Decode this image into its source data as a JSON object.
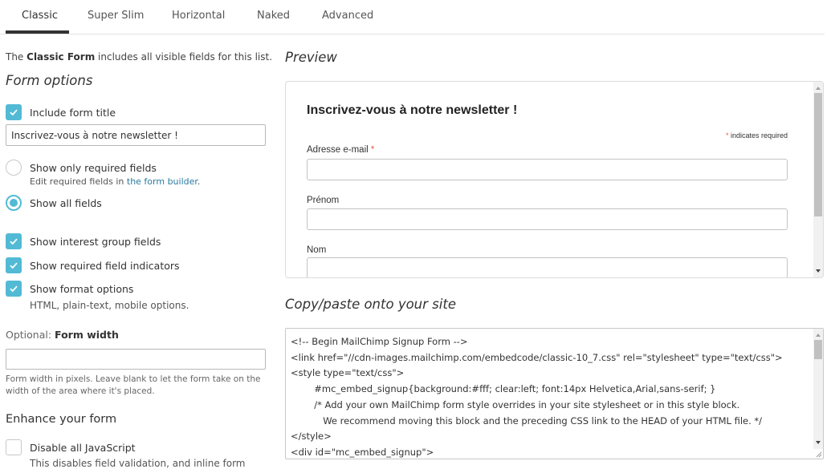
{
  "tabs": [
    {
      "label": "Classic",
      "active": true
    },
    {
      "label": "Super Slim",
      "active": false
    },
    {
      "label": "Horizontal",
      "active": false
    },
    {
      "label": "Naked",
      "active": false
    },
    {
      "label": "Advanced",
      "active": false
    }
  ],
  "left": {
    "intro": {
      "prefix": "The ",
      "bold": "Classic Form",
      "suffix": " includes all visible fields for this list."
    },
    "form_options_title": "Form options",
    "include_title": {
      "label": "Include form title",
      "checked": true
    },
    "title_input_value": "Inscrivez-vous à notre newsletter !",
    "radio_required": {
      "label": "Show only required fields",
      "selected": false,
      "sub_prefix": "Edit required fields in ",
      "sub_link": "the form builder",
      "sub_suffix": "."
    },
    "radio_all": {
      "label": "Show all fields",
      "selected": true
    },
    "checkboxes": [
      {
        "label": "Show interest group fields",
        "checked": true
      },
      {
        "label": "Show required field indicators",
        "checked": true
      },
      {
        "label": "Show format options",
        "checked": true
      }
    ],
    "format_sub": "HTML, plain-text, mobile options.",
    "form_width": {
      "optional_prefix": "Optional: ",
      "label": "Form width",
      "value": "",
      "help": "Form width in pixels. Leave blank to let the form take on the width of the area where it's placed."
    },
    "enhance_title": "Enhance your form",
    "disable_js": {
      "label": "Disable all JavaScript",
      "checked": false,
      "sub": "This disables field validation, and inline form"
    }
  },
  "preview": {
    "title": "Preview",
    "form_title": "Inscrivez-vous à notre newsletter !",
    "required_star": "*",
    "required_note": " indicates required",
    "fields": [
      {
        "label": "Adresse e-mail",
        "required": true
      },
      {
        "label": "Prénom",
        "required": false
      },
      {
        "label": "Nom",
        "required": false
      }
    ]
  },
  "code": {
    "title": "Copy/paste onto your site",
    "lines": [
      "<!-- Begin MailChimp Signup Form -->",
      "<link href=\"//cdn-images.mailchimp.com/embedcode/classic-10_7.css\" rel=\"stylesheet\" type=\"text/css\">",
      "<style type=\"text/css\">",
      "        #mc_embed_signup{background:#fff; clear:left; font:14px Helvetica,Arial,sans-serif; }",
      "        /* Add your own MailChimp form style overrides in your site stylesheet or in this style block.",
      "           We recommend moving this block and the preceding CSS link to the HEAD of your HTML file. */",
      "</style>",
      "<div id=\"mc_embed_signup\">"
    ]
  },
  "colors": {
    "accent": "#52bad5",
    "link": "#2a7aa0",
    "required": "#e85c41"
  }
}
